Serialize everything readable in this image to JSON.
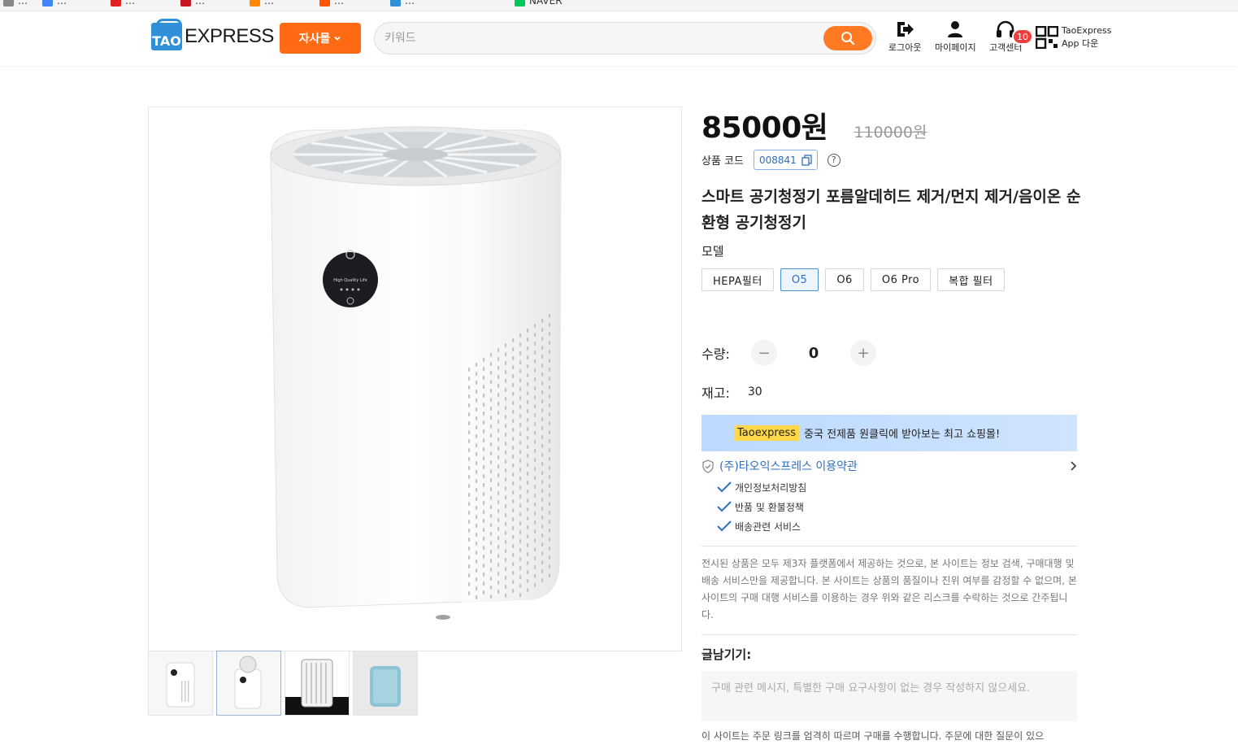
{
  "bookmarks": [
    {
      "label": "…",
      "color": "#888888"
    },
    {
      "label": "…",
      "color": "#4285f4"
    },
    {
      "label": "…",
      "color": "#e02020"
    },
    {
      "label": "…",
      "color": "#c81623"
    },
    {
      "label": "…",
      "color": "#ff8800"
    },
    {
      "label": "…",
      "color": "#ff5500"
    },
    {
      "label": "…",
      "color": "#2f8fd9"
    },
    {
      "label": "NAVER",
      "color": "#03c75a"
    }
  ],
  "header": {
    "logo_text": "EXPRESS",
    "logo_badge": "TAO",
    "category_button": "자사몰",
    "search_placeholder": "키워드",
    "logout": "로그아웃",
    "mypage": "마이페이지",
    "customer_center": "고객센터",
    "notification_count": "10",
    "app_line1": "TaoExpress",
    "app_line2": "App 다운",
    "brand_color": "#ff6a13"
  },
  "product": {
    "price_now": "85000원",
    "price_old": "110000원",
    "code_label": "상품 코드",
    "code_value": "008841",
    "help_symbol": "?",
    "title": "스마트 공기청정기 포름알데히드 제거/먼지 제거/음이온 순환형 공기청정기",
    "model_label": "모델",
    "options": [
      {
        "label": "HEPA필터",
        "selected": false
      },
      {
        "label": "O5",
        "selected": true
      },
      {
        "label": "O6",
        "selected": false
      },
      {
        "label": "O6 Pro",
        "selected": false
      },
      {
        "label": "복합 필터",
        "selected": false
      }
    ],
    "qty_label": "수량:",
    "qty_value": "0",
    "qty_minus": "−",
    "qty_plus": "+",
    "stock_label": "재고:",
    "stock_value": "30",
    "image_screen_text": "High Quality Life"
  },
  "promo": {
    "tag": "Taoexpress",
    "text": "중국 전제품 원클릭에 받아보는 최고 쇼핑몰!"
  },
  "terms": {
    "title": "(주)타오익스프레스 이용약관",
    "items": [
      "개인정보처리방침",
      "반품 및 환불정책",
      "배송관련 서비스"
    ]
  },
  "disclaimer": "전시된 상품은 모두 제3자 플랫폼에서 제공하는 것으로, 본 사이트는 정보 검색, 구매대행 및 배송 서비스만을 제공합니다. 본 사이트는 상품의 품질이나 진위 여부를 감정할 수 없으며, 본 사이트의 구매 대행 서비스를 이용하는 경우 위와 같은 리스크를 수락하는 것으로 간주됩니다.",
  "memo": {
    "label": "글남기기:",
    "placeholder": "구매 관련 메시지, 특별한 구매 요구사항이 없는 경우 작성하지 않으세요."
  },
  "bottom_note": "이 사이트는 주문 링크를 엄격히 따르며 구매를 수행합니다. 주문에 대한 질문이 있으"
}
